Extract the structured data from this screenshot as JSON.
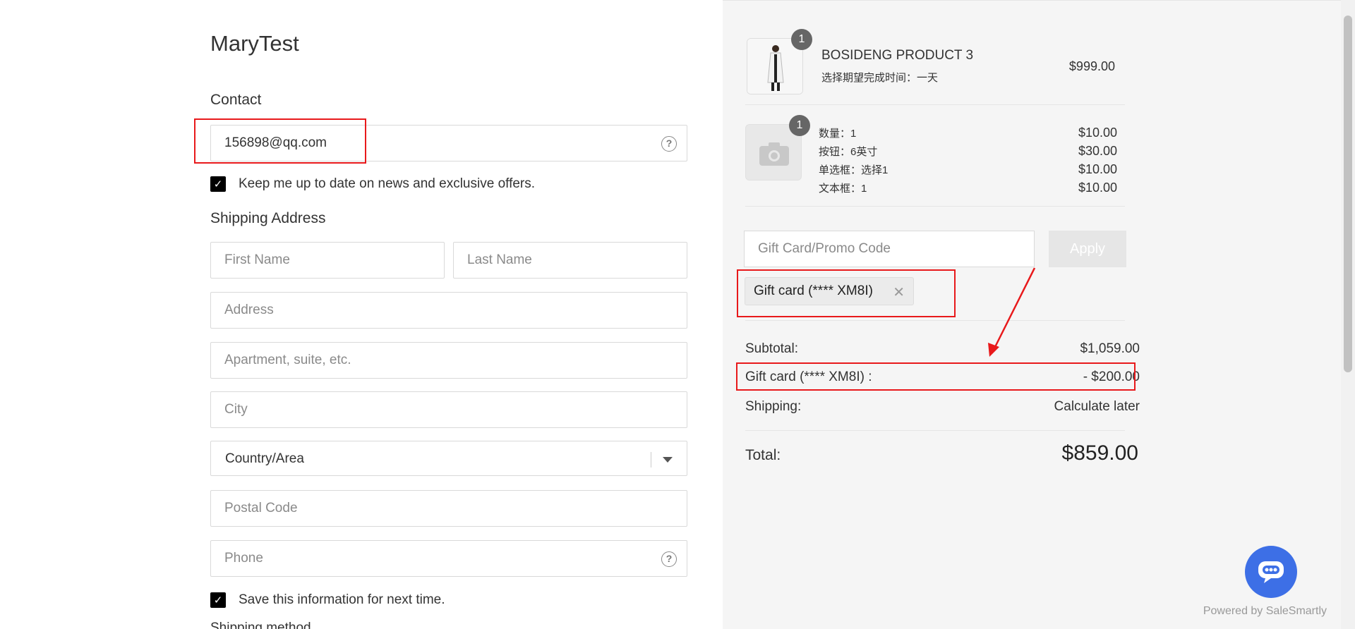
{
  "store": {
    "title": "MaryTest"
  },
  "contact": {
    "heading": "Contact",
    "email_value": "156898@qq.com",
    "newsletter_label": "Keep me up to date on news and exclusive offers.",
    "newsletter_checked": true
  },
  "shipping": {
    "heading": "Shipping Address",
    "first_name_placeholder": "First Name",
    "last_name_placeholder": "Last Name",
    "address_placeholder": "Address",
    "apartment_placeholder": "Apartment, suite, etc.",
    "city_placeholder": "City",
    "country_value": "Country/Area",
    "postal_placeholder": "Postal Code",
    "phone_placeholder": "Phone",
    "save_info_label": "Save this information for next time.",
    "save_info_checked": true,
    "cut_off_text": "Shipping method"
  },
  "cart": {
    "items": [
      {
        "quantity": "1",
        "name": "BOSIDENG PRODUCT 3",
        "subtitle": "选择期望完成时间：一天",
        "price": "$999.00"
      },
      {
        "quantity": "1",
        "options": [
          {
            "label": "数量：1",
            "price": "$10.00"
          },
          {
            "label": "按钮：6英寸",
            "price": "$30.00"
          },
          {
            "label": "单选框：选择1",
            "price": "$10.00"
          },
          {
            "label": "文本框：1",
            "price": "$10.00"
          }
        ]
      }
    ]
  },
  "promo": {
    "placeholder": "Gift Card/Promo Code",
    "apply_label": "Apply",
    "applied_chip": "Gift card (**** XM8I)"
  },
  "summary": {
    "subtotal_label": "Subtotal:",
    "subtotal_value": "$1,059.00",
    "giftcard_label": "Gift card (**** XM8I) :",
    "giftcard_value": "- $200.00",
    "shipping_label": "Shipping:",
    "shipping_value": "Calculate later",
    "total_label": "Total:",
    "total_value": "$859.00"
  },
  "footer": {
    "powered_by": "Powered by SaleSmartly"
  },
  "colors": {
    "annotation": "#e8191b",
    "chat_button": "#3d6fe6",
    "checkbox": "#000000"
  }
}
